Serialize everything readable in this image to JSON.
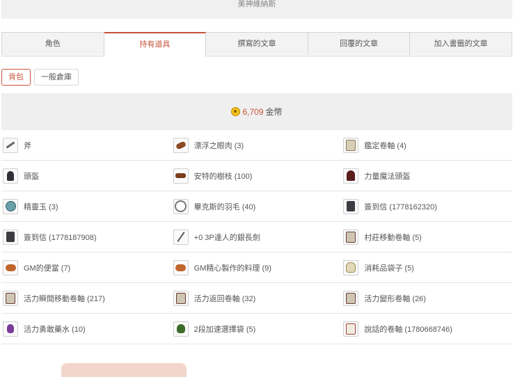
{
  "server": {
    "name": "美神維納斯"
  },
  "tabs": [
    "角色",
    "持有道具",
    "撰寫的文章",
    "回覆的文章",
    "加入書籤的文章"
  ],
  "active_tab": "持有道具",
  "storage_tabs": [
    "背包",
    "一般倉庫"
  ],
  "active_storage": "背包",
  "gold": {
    "amount": "6,709",
    "unit": "金幣"
  },
  "items": [
    [
      {
        "icon": "axe-icon",
        "name": "斧"
      },
      {
        "icon": "meat-icon",
        "name": "漂浮之眼肉 (3)"
      },
      {
        "icon": "scroll-icon",
        "name": "鑑定卷軸 (4)"
      }
    ],
    [
      {
        "icon": "helmet-icon",
        "name": "頭盔"
      },
      {
        "icon": "twig-icon",
        "name": "安特的樹枝 (100)"
      },
      {
        "icon": "hood-icon",
        "name": "力量魔法頭盔"
      }
    ],
    [
      {
        "icon": "orb-icon",
        "name": "精靈玉 (3)"
      },
      {
        "icon": "feather-icon",
        "name": "畢克斯的羽毛 (40)"
      },
      {
        "icon": "letter-icon",
        "name": "簽到信 (1778162320)"
      }
    ],
    [
      {
        "icon": "letter-icon",
        "name": "簽到信 (1778187908)"
      },
      {
        "icon": "sword-icon",
        "name": "+0 3P達人的銀長劍"
      },
      {
        "icon": "magic-scroll-icon",
        "name": "村莊移動卷軸 (5)"
      }
    ],
    [
      {
        "icon": "lunchbox-icon",
        "name": "GM的便當 (7)"
      },
      {
        "icon": "dish-icon",
        "name": "GM精心製作的料理 (9)"
      },
      {
        "icon": "bag-icon",
        "name": "消耗品袋子 (5)"
      }
    ],
    [
      {
        "icon": "magic-scroll-icon",
        "name": "活力瞬間移動卷軸 (217)"
      },
      {
        "icon": "magic-scroll-icon",
        "name": "活力返回卷軸 (32)"
      },
      {
        "icon": "magic-scroll-icon",
        "name": "活力變形卷軸 (26)"
      }
    ],
    [
      {
        "icon": "potion-icon",
        "name": "活力勇敢藥水 (10)"
      },
      {
        "icon": "sack-icon",
        "name": "2段加速選擇袋 (5)"
      },
      {
        "icon": "talk-scroll-icon",
        "name": "說話的卷軸 (1780668746)"
      }
    ]
  ]
}
